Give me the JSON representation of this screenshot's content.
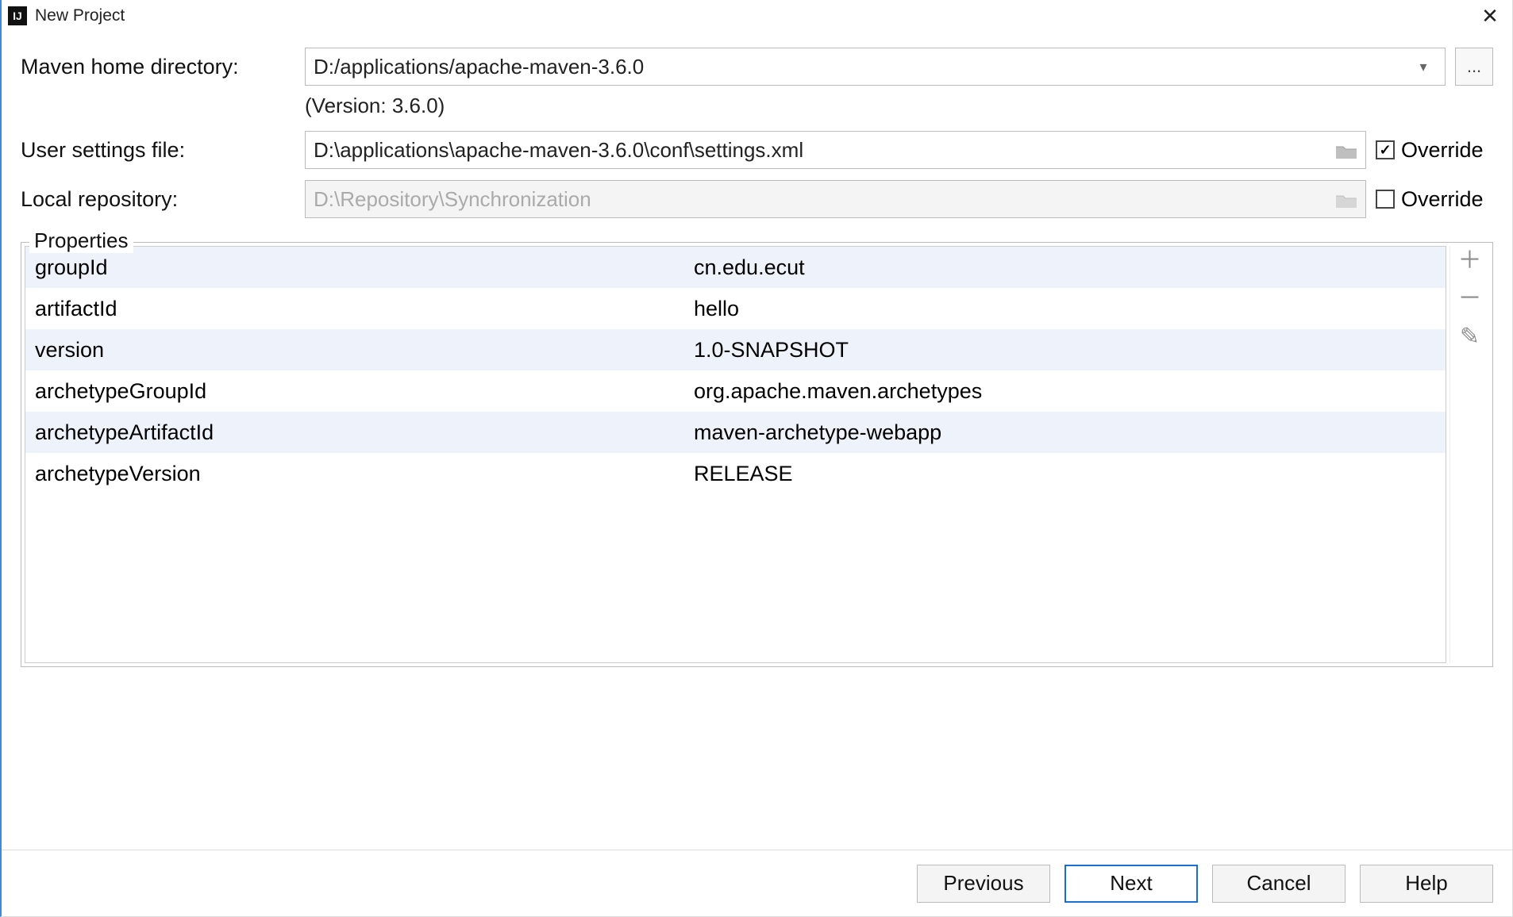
{
  "window": {
    "title": "New Project",
    "close_glyph": "✕"
  },
  "form": {
    "maven_home_label": "Maven home directory:",
    "maven_home_value": "D:/applications/apache-maven-3.6.0",
    "maven_version_note": "(Version: 3.6.0)",
    "user_settings_label": "User settings file:",
    "user_settings_value": "D:\\applications\\apache-maven-3.6.0\\conf\\settings.xml",
    "user_settings_override_label": "Override",
    "user_settings_override_checked": true,
    "local_repo_label": "Local repository:",
    "local_repo_value": "D:\\Repository\\Synchronization",
    "local_repo_override_label": "Override",
    "local_repo_override_checked": false
  },
  "properties": {
    "legend": "Properties",
    "rows": [
      {
        "key": "groupId",
        "value": "cn.edu.ecut"
      },
      {
        "key": "artifactId",
        "value": "hello"
      },
      {
        "key": "version",
        "value": "1.0-SNAPSHOT"
      },
      {
        "key": "archetypeGroupId",
        "value": "org.apache.maven.archetypes"
      },
      {
        "key": "archetypeArtifactId",
        "value": "maven-archetype-webapp"
      },
      {
        "key": "archetypeVersion",
        "value": "RELEASE"
      }
    ],
    "icons": {
      "add": "＋",
      "remove": "－",
      "edit": "✎"
    }
  },
  "buttons": {
    "previous": "Previous",
    "next": "Next",
    "cancel": "Cancel",
    "help": "Help"
  },
  "misc": {
    "ellipsis": "..."
  }
}
